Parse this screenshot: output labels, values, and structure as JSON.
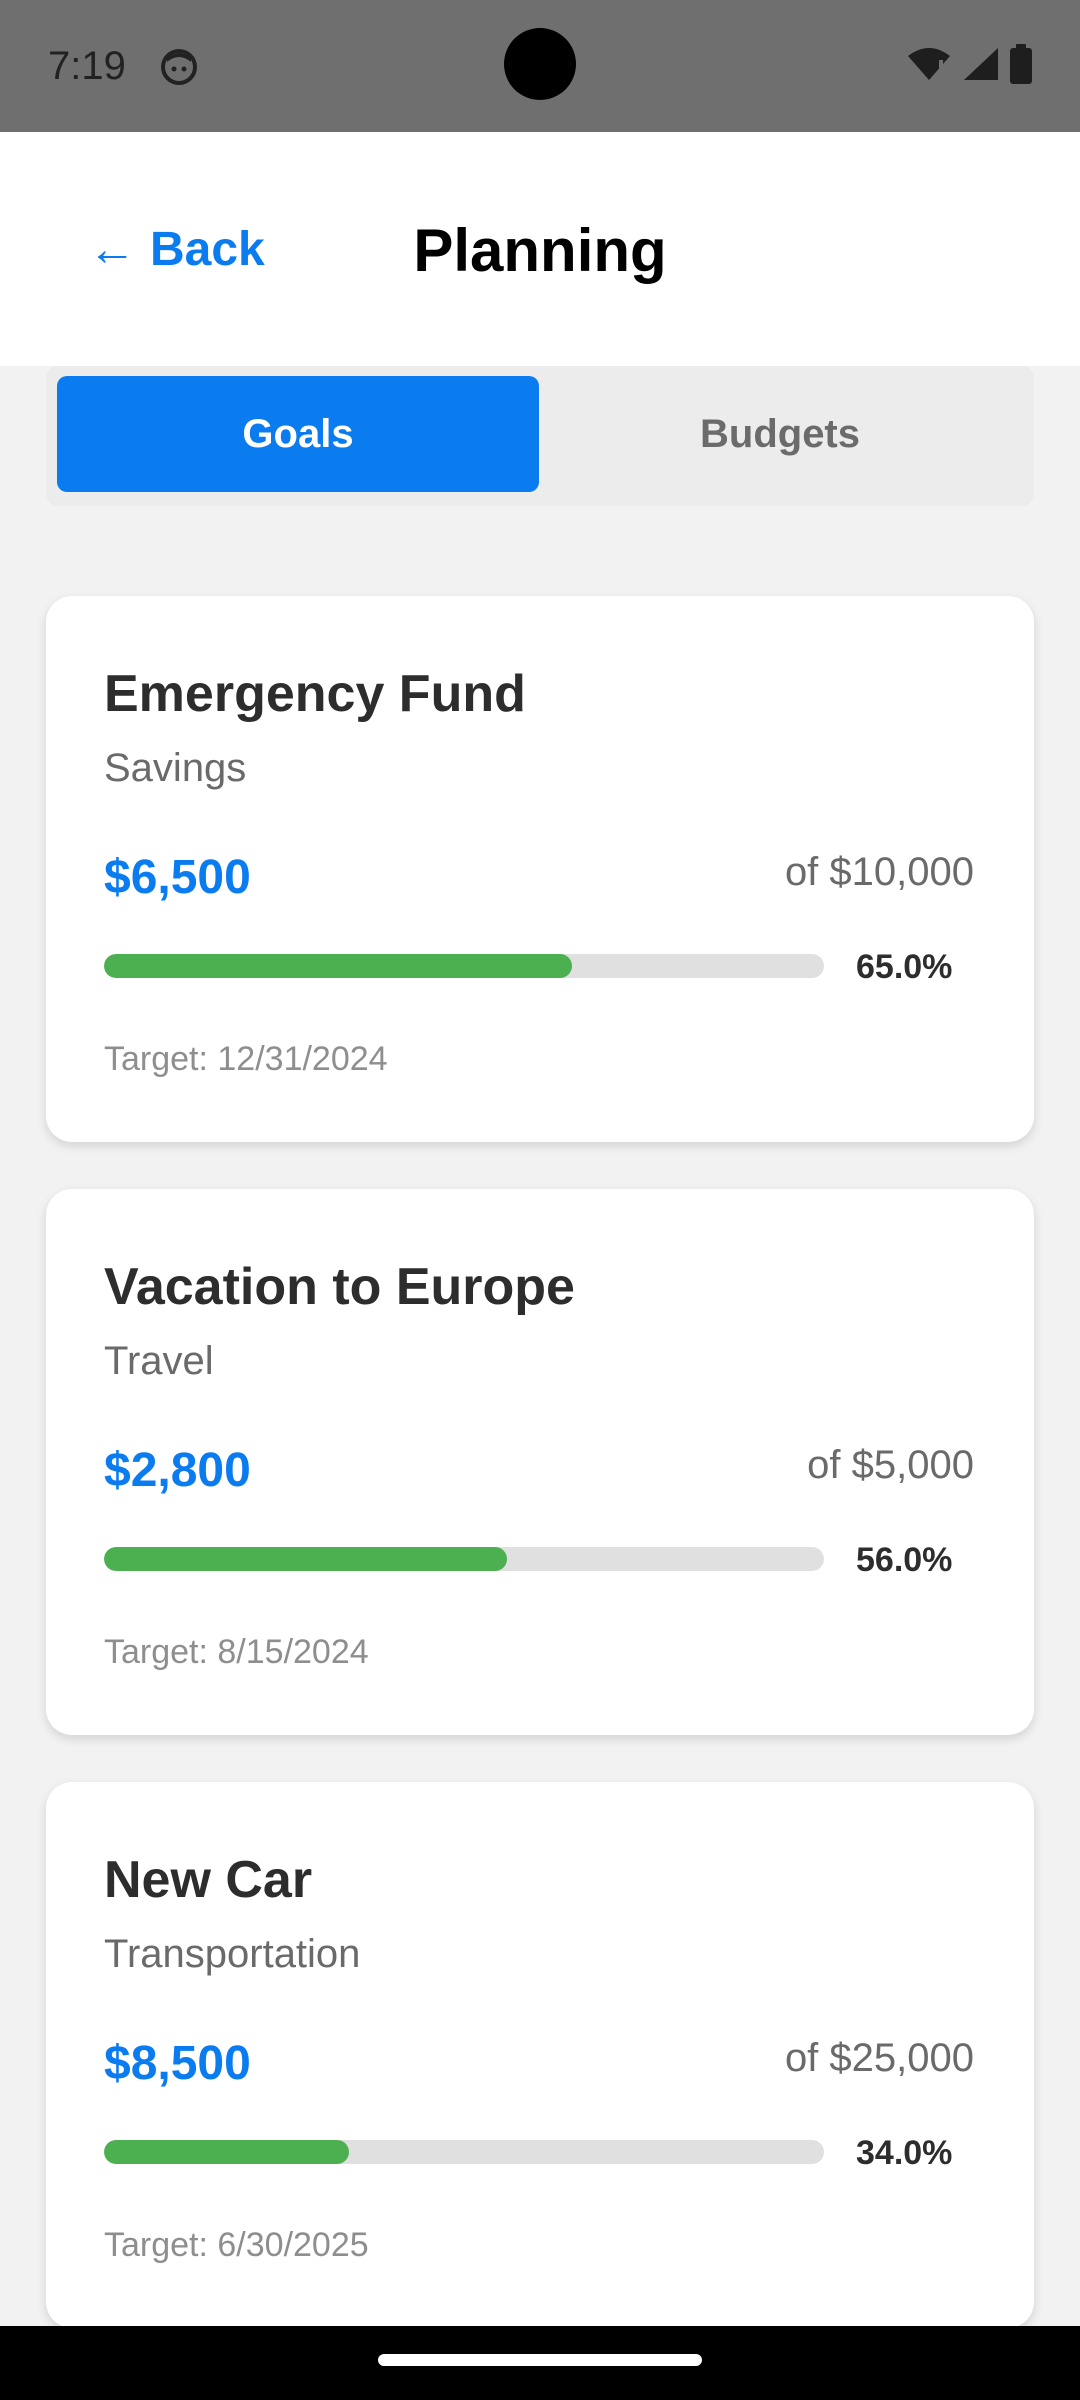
{
  "status_bar": {
    "time": "7:19",
    "icons": [
      "face-icon",
      "wifi-icon",
      "signal-icon",
      "battery-icon"
    ]
  },
  "header": {
    "back_label": "Back",
    "back_arrow": "←",
    "title": "Planning"
  },
  "tabs": [
    {
      "label": "Goals",
      "active": true
    },
    {
      "label": "Budgets",
      "active": false
    }
  ],
  "goals": [
    {
      "name": "Emergency Fund",
      "category": "Savings",
      "current": "$6,500",
      "target_text": "of $10,000",
      "progress": 0.65,
      "percent_label": "65.0%",
      "target_date": "Target: 12/31/2024"
    },
    {
      "name": "Vacation to Europe",
      "category": "Travel",
      "current": "$2,800",
      "target_text": "of $5,000",
      "progress": 0.56,
      "percent_label": "56.0%",
      "target_date": "Target: 8/15/2024"
    },
    {
      "name": "New Car",
      "category": "Transportation",
      "current": "$8,500",
      "target_text": "of $25,000",
      "progress": 0.34,
      "percent_label": "34.0%",
      "target_date": "Target: 6/30/2025"
    }
  ],
  "colors": {
    "accent": "#0a7cf0",
    "progress": "#4caf50",
    "track": "#e0e0e0"
  }
}
